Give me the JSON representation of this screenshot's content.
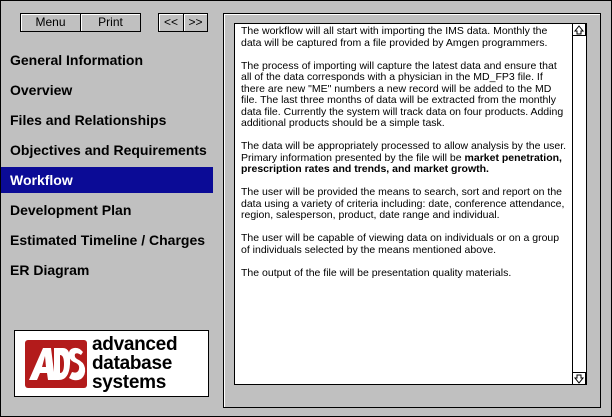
{
  "toolbar": {
    "menu_label": "Menu",
    "print_label": "Print",
    "prev_label": "<<",
    "next_label": ">>"
  },
  "nav": {
    "items": [
      {
        "label": "General Information"
      },
      {
        "label": "Overview"
      },
      {
        "label": "Files and Relationships"
      },
      {
        "label": "Objectives and Requirements"
      },
      {
        "label": "Workflow"
      },
      {
        "label": "Development Plan"
      },
      {
        "label": "Estimated Timeline / Charges"
      },
      {
        "label": "ER Diagram"
      }
    ],
    "active": "Workflow",
    "active_color": "#0b0b96"
  },
  "logo": {
    "mark": "ADS",
    "line1": "advanced",
    "line2": "database",
    "line3": "systems",
    "mark_color": "#b31b1b"
  },
  "content": {
    "p1": "The workflow will all start with importing the IMS data.  Monthly the data will be captured from a file provided by Amgen programmers.",
    "p2": "The process of importing will capture the latest data and ensure that all of the data corresponds with a physician in the MD_FP3 file.  If there are new \"ME\" numbers a new record will be added to the MD file.  The last three months of data will be extracted from the monthly data file.  Currently the system will track data on four products.  Adding additional products should be a simple task.",
    "p3_plain": "The data will be appropriately processed to allow analysis by the user.  Primary information presented by the file will be ",
    "p3_bold": "market penetration, prescription rates and trends, and market growth.",
    "p4": "The user will be provided the means to search, sort and report on the data using a variety of criteria including: date, conference attendance, region, salesperson, product, date range and individual.",
    "p5": "The user will be capable of viewing data on individuals or on a group of individuals selected by the means mentioned above.",
    "p6": "The output of the file will be presentation quality materials."
  },
  "scrollbar": {
    "up_icon": "arrow-up-icon",
    "down_icon": "arrow-down-icon"
  }
}
